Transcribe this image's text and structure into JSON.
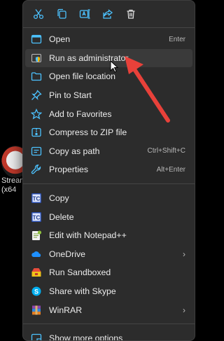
{
  "desktop_icon": {
    "label_lines": [
      "Stream",
      "(x64"
    ]
  },
  "toolbar": [
    {
      "icon": "cut-icon"
    },
    {
      "icon": "copy-icon"
    },
    {
      "icon": "rename-icon"
    },
    {
      "icon": "share-icon"
    },
    {
      "icon": "delete-icon"
    }
  ],
  "menu_section_1": [
    {
      "icon": "open-icon",
      "label": "Open",
      "shortcut": "Enter"
    },
    {
      "icon": "shield-icon",
      "label": "Run as administrator",
      "shortcut": "",
      "hover": true
    },
    {
      "icon": "folder-icon",
      "label": "Open file location",
      "shortcut": ""
    },
    {
      "icon": "pin-icon",
      "label": "Pin to Start",
      "shortcut": ""
    },
    {
      "icon": "star-icon",
      "label": "Add to Favorites",
      "shortcut": ""
    },
    {
      "icon": "zip-icon",
      "label": "Compress to ZIP file",
      "shortcut": ""
    },
    {
      "icon": "copy-path-icon",
      "label": "Copy as path",
      "shortcut": "Ctrl+Shift+C"
    },
    {
      "icon": "wrench-icon",
      "label": "Properties",
      "shortcut": "Alt+Enter"
    }
  ],
  "menu_section_2": [
    {
      "icon": "tc-icon",
      "label": "Copy",
      "submenu": false
    },
    {
      "icon": "tc-icon",
      "label": "Delete",
      "submenu": false
    },
    {
      "icon": "notepadpp-icon",
      "label": "Edit with Notepad++",
      "submenu": false
    },
    {
      "icon": "onedrive-icon",
      "label": "OneDrive",
      "submenu": true
    },
    {
      "icon": "sandbox-icon",
      "label": "Run Sandboxed",
      "submenu": false
    },
    {
      "icon": "skype-icon",
      "label": "Share with Skype",
      "submenu": false
    },
    {
      "icon": "winrar-icon",
      "label": "WinRAR",
      "submenu": true
    }
  ],
  "menu_section_3": [
    {
      "icon": "more-options-icon",
      "label": "Show more options"
    }
  ],
  "chevron_glyph": "›",
  "colors": {
    "accent": "#4cc2ff",
    "arrow": "#e8413a",
    "menu_bg": "#2c2c2c",
    "hover": "#3a3a3a"
  }
}
